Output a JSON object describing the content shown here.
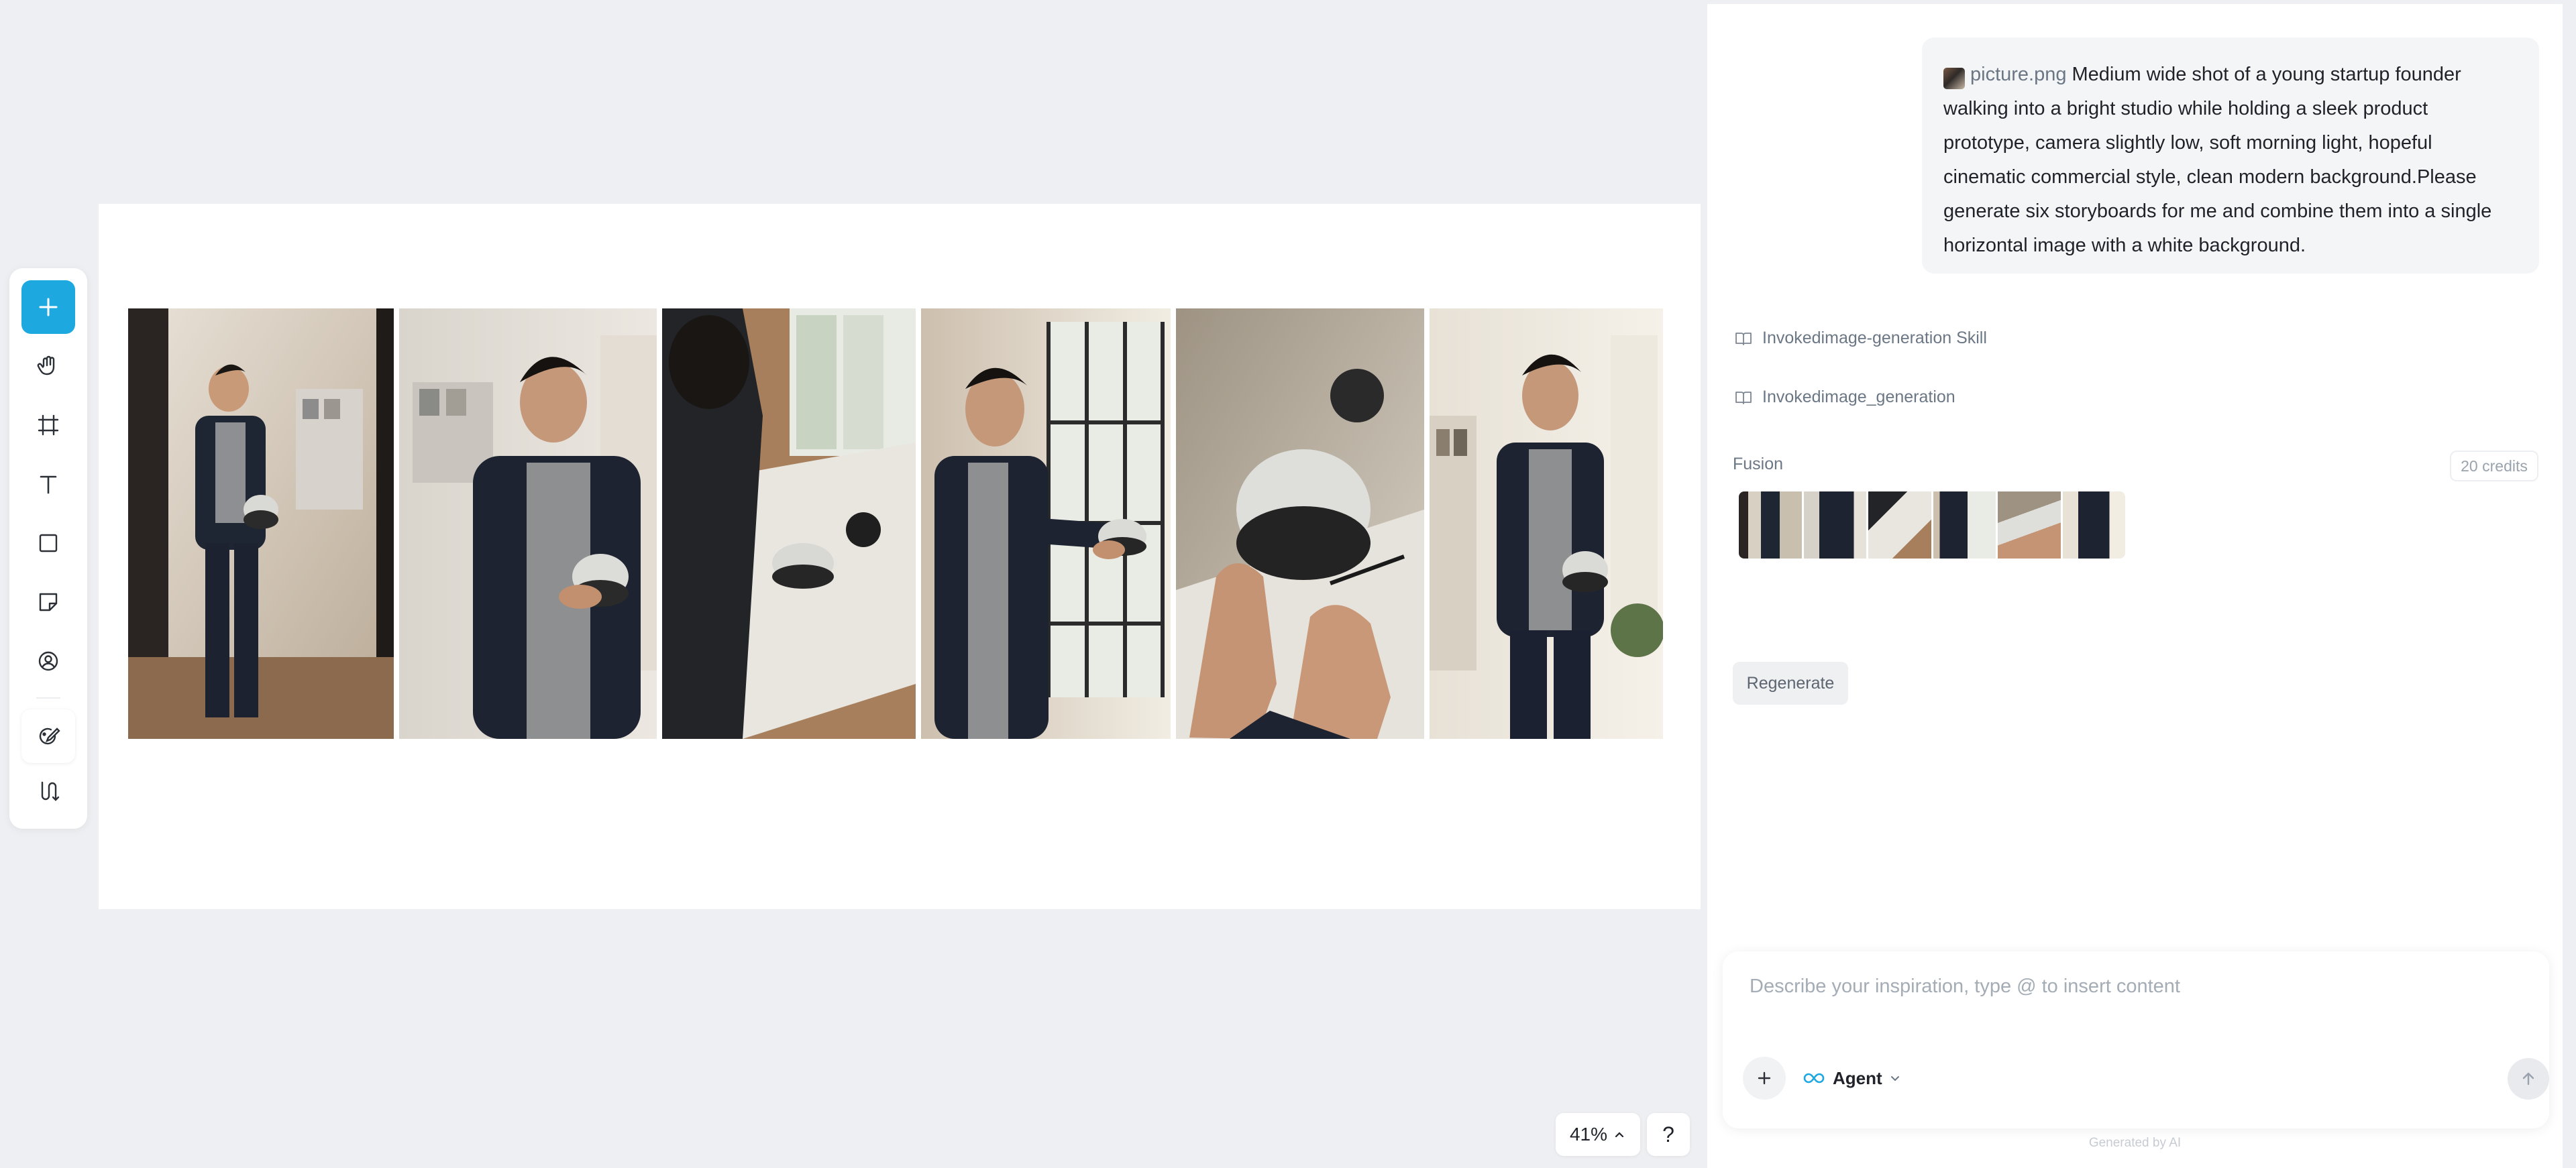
{
  "toolbar": {
    "items": [
      {
        "name": "add",
        "icon": "plus-icon"
      },
      {
        "name": "hand",
        "icon": "hand-icon"
      },
      {
        "name": "frame",
        "icon": "frame-crop-icon"
      },
      {
        "name": "text",
        "icon": "text-icon"
      },
      {
        "name": "rectangle",
        "icon": "square-icon"
      },
      {
        "name": "sticky",
        "icon": "sticky-note-icon"
      },
      {
        "name": "person",
        "icon": "person-circle-icon"
      },
      {
        "name": "brush",
        "icon": "brush-palette-icon"
      },
      {
        "name": "flow",
        "icon": "flow-branch-icon"
      }
    ],
    "accent": "#1ea8e0"
  },
  "canvas": {
    "storyboard_frames": 6
  },
  "zoom": {
    "level": "41%"
  },
  "help": {
    "label": "?"
  },
  "chat": {
    "user_message": {
      "attachment_name": "picture.png",
      "text": "Medium wide shot of a young startup founder walking into a bright studio while holding a sleek product prototype, camera slightly low, soft morning light, hopeful cinematic commercial style, clean modern background.Please generate six storyboards for me and combine them into a single horizontal image with a white background."
    },
    "skill_steps": [
      {
        "label": "Invokedimage-generation Skill",
        "icon": "book-icon"
      },
      {
        "label": "Invokedimage_generation",
        "icon": "book-icon"
      }
    ],
    "result": {
      "title": "Fusion",
      "credits": "20 credits",
      "thumbnail_count": 6
    },
    "regenerate_label": "Regenerate",
    "composer": {
      "placeholder": "Describe your inspiration, type @ to insert content",
      "mode_label": "Agent"
    },
    "footer_note": "Generated by AI"
  }
}
